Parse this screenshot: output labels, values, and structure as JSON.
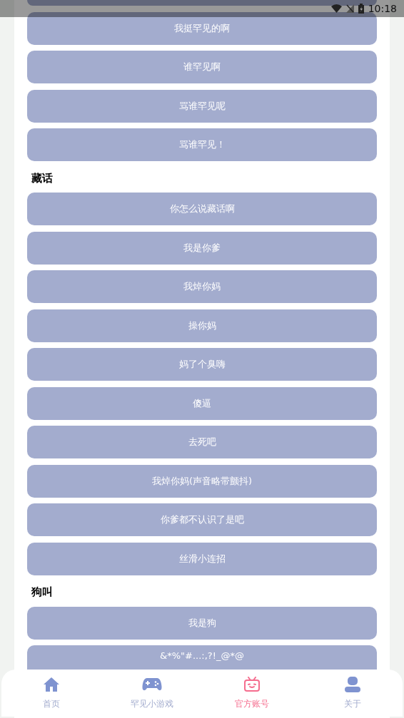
{
  "status_bar": {
    "time": "10:18"
  },
  "sections": [
    {
      "buttons": [
        "我挺罕见的啊",
        "谁罕见啊",
        "骂谁罕见呢",
        "骂谁罕见！"
      ]
    },
    {
      "heading": "藏话",
      "buttons": [
        "你怎么说藏话啊",
        "我是你爹",
        "我焯你妈",
        "操你妈",
        "妈了个臭嗨",
        "傻逼",
        "去死吧",
        "我焯你妈(声音略带颤抖)",
        "你爹都不认识了是吧",
        "丝滑小连招"
      ]
    },
    {
      "heading": "狗叫",
      "buttons": [
        "我是狗",
        "&*%\"#...:,?!_@*@"
      ]
    }
  ],
  "nav": [
    {
      "label": "首页",
      "kind": "home",
      "selected": false
    },
    {
      "label": "罕见小游戏",
      "kind": "game",
      "selected": false
    },
    {
      "label": "官方账号",
      "kind": "tv",
      "selected": true
    },
    {
      "label": "关于",
      "kind": "user",
      "selected": false
    }
  ]
}
